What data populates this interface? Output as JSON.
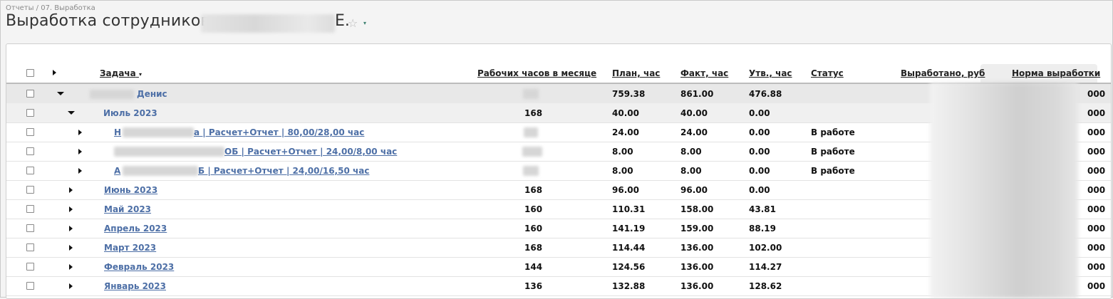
{
  "breadcrumb": "Отчеты / 07. Выработка",
  "page": {
    "title": "Выработка сотрудников",
    "title_suffix": "Е.",
    "star": "☆",
    "dropdown": "▾"
  },
  "columns": {
    "task": "Задача",
    "task_sort": "▾",
    "hours_month": "Рабочих часов в месяце",
    "plan": "План, час",
    "fact": "Факт, час",
    "approved": "Утв., час",
    "status": "Статус",
    "earned": "Выработано, руб",
    "norm": "Норма выработки"
  },
  "rows": [
    {
      "label": "Денис",
      "hours": "",
      "plan": "759.38",
      "fact": "861.00",
      "approved": "476.88",
      "status": "",
      "norm_tail": "000"
    },
    {
      "label": "Июль 2023",
      "hours": "168",
      "plan": "40.00",
      "fact": "40.00",
      "approved": "0.00",
      "status": "",
      "norm_tail": "000"
    },
    {
      "label": "Н",
      "label_rest": "а | Расчет+Отчет | 80,00/28,00 час",
      "hours": "",
      "plan": "24.00",
      "fact": "24.00",
      "approved": "0.00",
      "status": "В работе",
      "norm_tail": "000"
    },
    {
      "label": "",
      "label_rest": "ОБ | Расчет+Отчет | 24,00/8,00 час",
      "hours": "",
      "plan": "8.00",
      "fact": "8.00",
      "approved": "0.00",
      "status": "В работе",
      "norm_tail": "000"
    },
    {
      "label": "А",
      "label_rest": "Б | Расчет+Отчет | 24,00/16,50 час",
      "hours": "",
      "plan": "8.00",
      "fact": "8.00",
      "approved": "0.00",
      "status": "В работе",
      "norm_tail": "000"
    },
    {
      "label": "Июнь 2023",
      "hours": "168",
      "plan": "96.00",
      "fact": "96.00",
      "approved": "0.00",
      "status": "",
      "norm_tail": "000"
    },
    {
      "label": "Май 2023",
      "hours": "160",
      "plan": "110.31",
      "fact": "158.00",
      "approved": "43.81",
      "status": "",
      "norm_tail": "000"
    },
    {
      "label": "Апрель 2023",
      "hours": "160",
      "plan": "141.19",
      "fact": "159.00",
      "approved": "88.19",
      "status": "",
      "norm_tail": "000"
    },
    {
      "label": "Март 2023",
      "hours": "168",
      "plan": "114.44",
      "fact": "136.00",
      "approved": "102.00",
      "status": "",
      "norm_tail": "000"
    },
    {
      "label": "Февраль 2023",
      "hours": "144",
      "plan": "124.56",
      "fact": "136.00",
      "approved": "114.27",
      "status": "",
      "norm_tail": "000"
    },
    {
      "label": "Январь 2023",
      "hours": "136",
      "plan": "132.88",
      "fact": "136.00",
      "approved": "128.62",
      "status": "",
      "norm_tail": "000"
    }
  ]
}
